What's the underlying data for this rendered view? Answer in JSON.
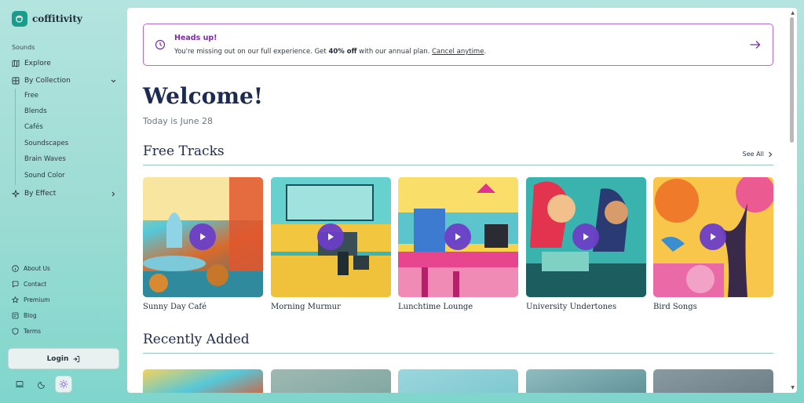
{
  "brand": {
    "name": "coffitivity"
  },
  "sidebar": {
    "section_label": "Sounds",
    "explore": "Explore",
    "by_collection": "By Collection",
    "collection_items": [
      "Free",
      "Blends",
      "Cafés",
      "Soundscapes",
      "Brain Waves",
      "Sound Color"
    ],
    "by_effect": "By Effect",
    "footer": [
      "About Us",
      "Contact",
      "Premium",
      "Blog",
      "Terms"
    ],
    "login_label": "Login"
  },
  "banner": {
    "title": "Heads up!",
    "text_before": "You're missing out on our full experience. Get ",
    "text_bold": "40% off",
    "text_after": " with our annual plan. ",
    "link": "Cancel anytime",
    "text_end": "."
  },
  "welcome": {
    "title": "Welcome!",
    "date": "Today is June 28"
  },
  "free_tracks": {
    "title": "Free Tracks",
    "see_all": "See All",
    "items": [
      {
        "title": "Sunny Day Café"
      },
      {
        "title": "Morning Murmur"
      },
      {
        "title": "Lunchtime Lounge"
      },
      {
        "title": "University Undertones"
      },
      {
        "title": "Bird Songs"
      }
    ]
  },
  "recently_added": {
    "title": "Recently Added"
  },
  "colors": {
    "accent": "#7a2fa8",
    "play": "#6c3fc7",
    "heading": "#1d2b52",
    "sidebar_bg": "#9ddcd4"
  }
}
